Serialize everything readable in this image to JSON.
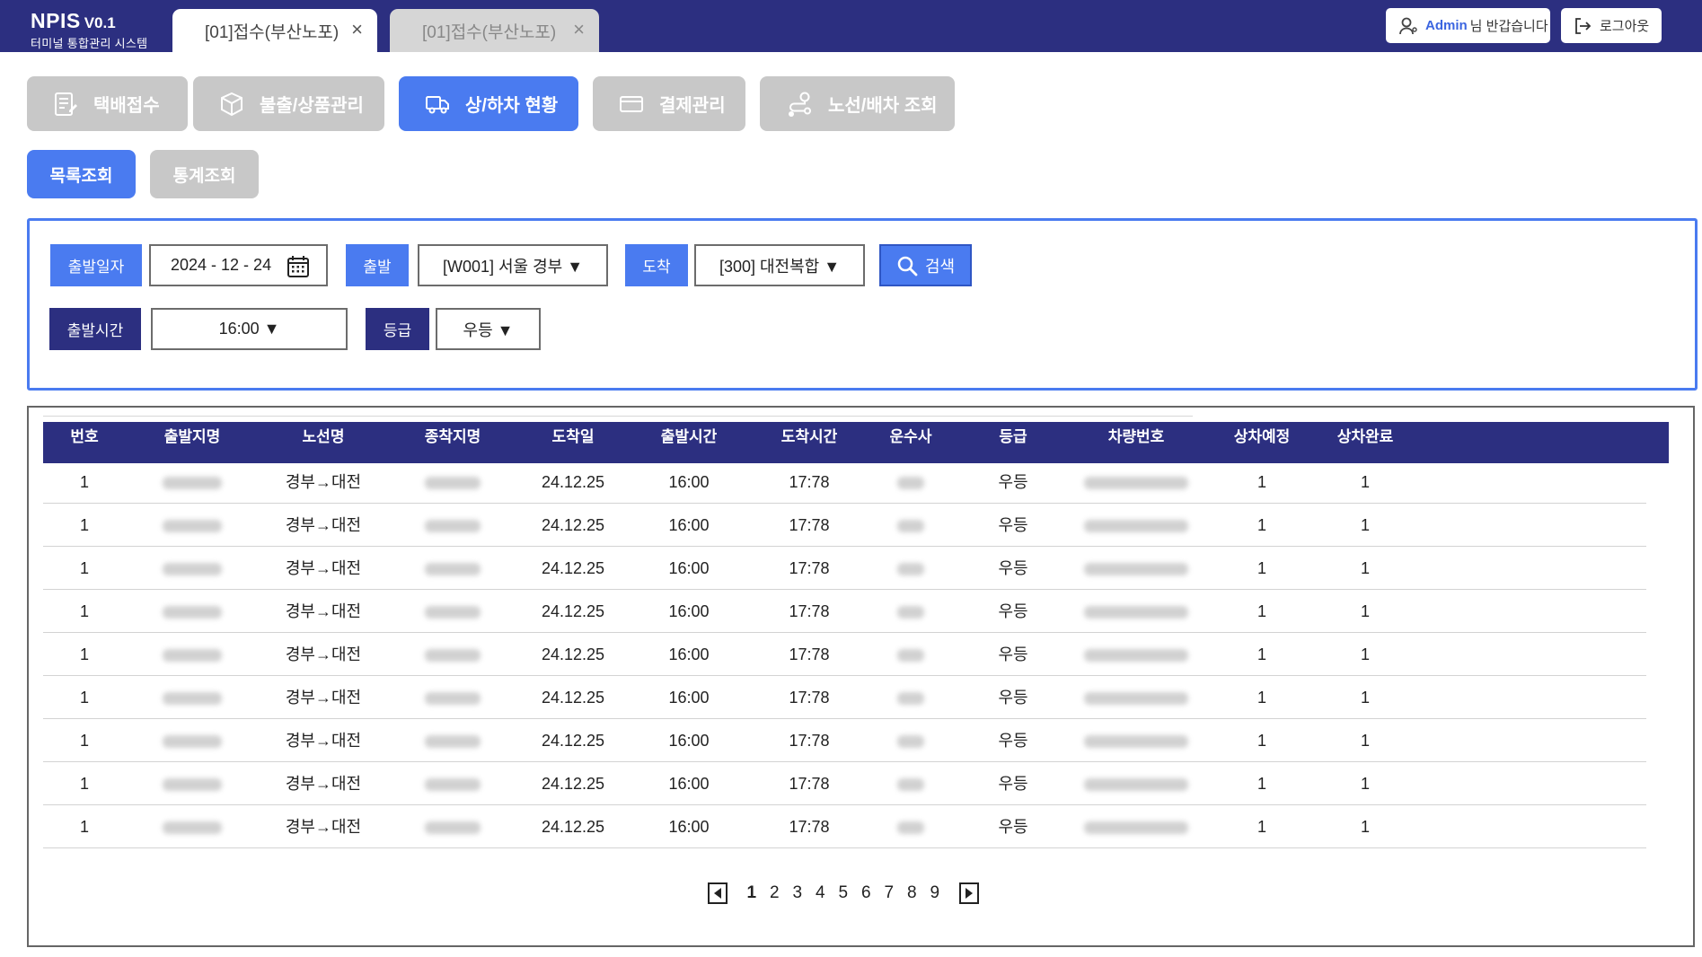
{
  "app": {
    "name": "NPIS",
    "version": "V0.1",
    "subtitle": "터미널 통합관리 시스템"
  },
  "tabs": [
    {
      "label": "[01]접수(부산노포)",
      "active": true
    },
    {
      "label": "[01]접수(부산노포)",
      "active": false
    }
  ],
  "header": {
    "user_name": "Admin",
    "greeting": "님 반갑습니다",
    "logout_label": "로그아웃"
  },
  "menu": [
    {
      "label": "택배접수",
      "icon": "form-edit-icon",
      "active": false
    },
    {
      "label": "불출/상품관리",
      "icon": "package-box-icon",
      "active": false
    },
    {
      "label": "상/하차 현황",
      "icon": "truck-icon",
      "active": true
    },
    {
      "label": "결제관리",
      "icon": "credit-card-icon",
      "active": false
    },
    {
      "label": "노선/배차 조회",
      "icon": "route-icon",
      "active": false
    }
  ],
  "subtabs": [
    {
      "label": "목록조회",
      "active": true
    },
    {
      "label": "통계조회",
      "active": false
    }
  ],
  "search": {
    "date_label": "출발일자",
    "date_value": "2024 - 12 - 24",
    "depart_label": "출발",
    "depart_value": "[W001] 서울 경부 ▼",
    "arrive_label": "도착",
    "arrive_value": "[300] 대전복합 ▼",
    "search_label": "검색",
    "time_label": "출발시간",
    "time_value": "16:00 ▼",
    "grade_label": "등급",
    "grade_value": "우등 ▼"
  },
  "table": {
    "columns": [
      "번호",
      "출발지명",
      "노선명",
      "종착지명",
      "도착일",
      "출발시간",
      "도착시간",
      "운수사",
      "등급",
      "차량번호",
      "상차예정",
      "상차완료"
    ],
    "rows": [
      [
        "1",
        "",
        "경부→대전",
        "",
        "24.12.25",
        "16:00",
        "17:78",
        "",
        "우등",
        "",
        "1",
        "1"
      ],
      [
        "1",
        "",
        "경부→대전",
        "",
        "24.12.25",
        "16:00",
        "17:78",
        "",
        "우등",
        "",
        "1",
        "1"
      ],
      [
        "1",
        "",
        "경부→대전",
        "",
        "24.12.25",
        "16:00",
        "17:78",
        "",
        "우등",
        "",
        "1",
        "1"
      ],
      [
        "1",
        "",
        "경부→대전",
        "",
        "24.12.25",
        "16:00",
        "17:78",
        "",
        "우등",
        "",
        "1",
        "1"
      ],
      [
        "1",
        "",
        "경부→대전",
        "",
        "24.12.25",
        "16:00",
        "17:78",
        "",
        "우등",
        "",
        "1",
        "1"
      ],
      [
        "1",
        "",
        "경부→대전",
        "",
        "24.12.25",
        "16:00",
        "17:78",
        "",
        "우등",
        "",
        "1",
        "1"
      ],
      [
        "1",
        "",
        "경부→대전",
        "",
        "24.12.25",
        "16:00",
        "17:78",
        "",
        "우등",
        "",
        "1",
        "1"
      ],
      [
        "1",
        "",
        "경부→대전",
        "",
        "24.12.25",
        "16:00",
        "17:78",
        "",
        "우등",
        "",
        "1",
        "1"
      ],
      [
        "1",
        "",
        "경부→대전",
        "",
        "24.12.25",
        "16:00",
        "17:78",
        "",
        "우등",
        "",
        "1",
        "1"
      ]
    ]
  },
  "pagination": {
    "current": "1",
    "pages": [
      "1",
      "2",
      "3",
      "4",
      "5",
      "6",
      "7",
      "8",
      "9"
    ]
  },
  "colors": {
    "navy": "#2c2f80",
    "accent": "#4a7bf0",
    "inactive": "#c8c8c8"
  }
}
